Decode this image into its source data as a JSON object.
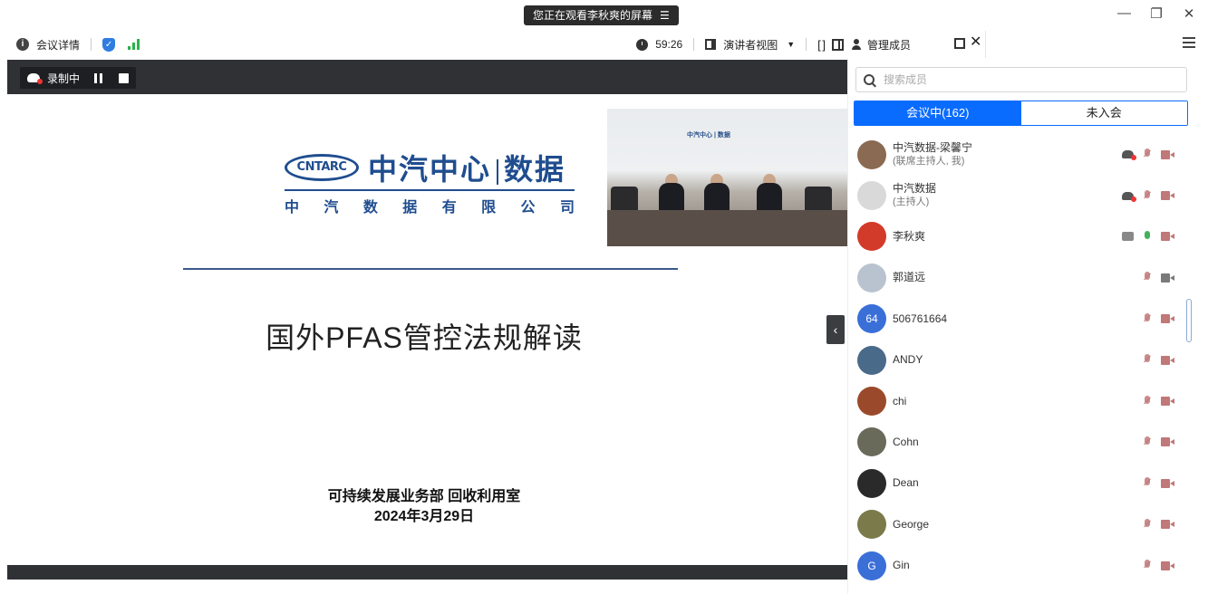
{
  "titlebar": {
    "screen_banner": "您正在观看李秋爽的屏幕",
    "banner_menu_icon": "menu-icon",
    "window_controls": {
      "minimize": "—",
      "restore": "❐",
      "close": "✕"
    }
  },
  "toolbar": {
    "meeting_details": "会议详情",
    "timer": "59:26",
    "presenter_view": "演讲者视图"
  },
  "panel_header": {
    "title": "管理成员"
  },
  "recording": {
    "label": "录制中"
  },
  "slide": {
    "logo_oval": "CNTARC",
    "logo_cn_left": "中汽中心",
    "logo_cn_right": "数据",
    "logo_sub": [
      "中",
      "汽",
      "数",
      "据",
      "有",
      "限",
      "公",
      "司"
    ],
    "title": "国外PFAS管控法规解读",
    "department": "可持续发展业务部  回收利用室",
    "date": "2024年3月29日"
  },
  "video": {
    "sign_text": "中汽中心 | 数据"
  },
  "members_panel": {
    "search_placeholder": "搜索成员",
    "tab_in_meeting": "会议中(162)",
    "tab_not_joined": "未入会",
    "members": [
      {
        "name": "中汽数据-梁馨宁",
        "role": "(联席主持人, 我)",
        "avatar_color": "#8a6a52",
        "avatar_text": "",
        "icons": [
          "cloud",
          "mic-off",
          "cam-off"
        ]
      },
      {
        "name": "中汽数据",
        "role": "(主持人)",
        "avatar_color": "#d9d9d9",
        "avatar_text": "",
        "icons": [
          "cloud",
          "mic-off",
          "cam-off"
        ]
      },
      {
        "name": "李秋爽",
        "role": "",
        "avatar_color": "#d23a2a",
        "avatar_text": "",
        "icons": [
          "share",
          "mic-on",
          "cam-off"
        ]
      },
      {
        "name": "郭道远",
        "role": "",
        "avatar_color": "#b9c3cf",
        "avatar_text": "",
        "icons": [
          "mic-off",
          "cam-plain"
        ]
      },
      {
        "name": "506761664",
        "role": "",
        "avatar_color": "#3a6fd8",
        "avatar_text": "64",
        "icons": [
          "mic-off",
          "cam-off"
        ]
      },
      {
        "name": "ANDY",
        "role": "",
        "avatar_color": "#4a6a8a",
        "avatar_text": "",
        "icons": [
          "mic-off",
          "cam-off"
        ]
      },
      {
        "name": "chi",
        "role": "",
        "avatar_color": "#9a4a2a",
        "avatar_text": "",
        "icons": [
          "mic-off",
          "cam-off"
        ]
      },
      {
        "name": "Cohn",
        "role": "",
        "avatar_color": "#6a6a5a",
        "avatar_text": "",
        "icons": [
          "mic-off",
          "cam-off"
        ]
      },
      {
        "name": "Dean",
        "role": "",
        "avatar_color": "#2a2a2a",
        "avatar_text": "",
        "icons": [
          "mic-off",
          "cam-off"
        ]
      },
      {
        "name": "George",
        "role": "",
        "avatar_color": "#7a7a4a",
        "avatar_text": "",
        "icons": [
          "mic-off",
          "cam-off"
        ]
      },
      {
        "name": "Gin",
        "role": "",
        "avatar_color": "#3a6fd8",
        "avatar_text": "G",
        "icons": [
          "mic-off",
          "cam-off"
        ]
      }
    ]
  }
}
